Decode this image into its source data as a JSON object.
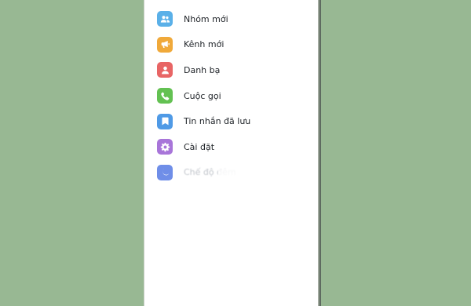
{
  "menu": {
    "items": [
      {
        "label": "Nhóm mới",
        "icon": "users-icon",
        "color": "#5ab0e8"
      },
      {
        "label": "Kênh mới",
        "icon": "megaphone-icon",
        "color": "#f0a93a"
      },
      {
        "label": "Danh bạ",
        "icon": "person-icon",
        "color": "#e86565"
      },
      {
        "label": "Cuộc gọi",
        "icon": "phone-icon",
        "color": "#63c152"
      },
      {
        "label": "Tin nhắn đã lưu",
        "icon": "bookmark-icon",
        "color": "#4f9ae6"
      },
      {
        "label": "Cài đặt",
        "icon": "gear-icon",
        "color": "#a875d9"
      },
      {
        "label": "Chế độ đêm",
        "icon": "moon-icon",
        "color": "#6f8ee8"
      }
    ]
  }
}
